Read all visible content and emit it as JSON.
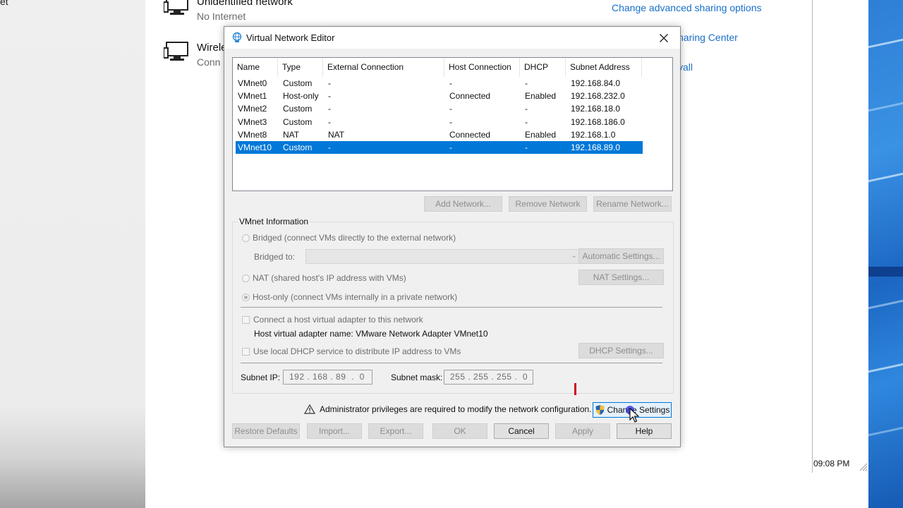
{
  "background": {
    "left_fragment": "et",
    "networks": [
      {
        "name": "Unidentified network",
        "status": "No Internet"
      },
      {
        "name": "Wirele",
        "status": "Conn"
      }
    ],
    "links": {
      "advanced_sharing": "Change advanced sharing options",
      "sharing_center": "haring Center",
      "firewall": "vall"
    },
    "clock": "09:08 PM"
  },
  "dialog": {
    "title": "Virtual Network Editor",
    "table": {
      "columns": [
        "Name",
        "Type",
        "External Connection",
        "Host Connection",
        "DHCP",
        "Subnet Address"
      ],
      "rows": [
        [
          "VMnet0",
          "Custom",
          "-",
          "-",
          "-",
          "192.168.84.0"
        ],
        [
          "VMnet1",
          "Host-only",
          "-",
          "Connected",
          "Enabled",
          "192.168.232.0"
        ],
        [
          "VMnet2",
          "Custom",
          "-",
          "-",
          "-",
          "192.168.18.0"
        ],
        [
          "VMnet3",
          "Custom",
          "-",
          "-",
          "-",
          "192.168.186.0"
        ],
        [
          "VMnet8",
          "NAT",
          "NAT",
          "Connected",
          "Enabled",
          "192.168.1.0"
        ],
        [
          "VMnet10",
          "Custom",
          "-",
          "-",
          "-",
          "192.168.89.0"
        ]
      ],
      "selected_row": 5
    },
    "buttons": {
      "add_network": "Add Network...",
      "remove_network": "Remove Network",
      "rename_network": "Rename Network...",
      "automatic_settings": "Automatic Settings...",
      "nat_settings": "NAT Settings...",
      "dhcp_settings": "DHCP Settings...",
      "change_settings": "Change Settings",
      "restore_defaults": "Restore Defaults",
      "import": "Import...",
      "export": "Export...",
      "ok": "OK",
      "cancel": "Cancel",
      "apply": "Apply",
      "help": "Help"
    },
    "vmnet_info": {
      "group_label": "VMnet Information",
      "bridged_label": "Bridged (connect VMs directly to the external network)",
      "bridged_to_label": "Bridged to:",
      "bridged_to_value": "",
      "nat_label": "NAT (shared host's IP address with VMs)",
      "hostonly_label": "Host-only (connect VMs internally in a private network)",
      "selected_mode": "Host-only",
      "connect_adapter_label": "Connect a host virtual adapter to this network",
      "connect_adapter_checked": false,
      "adapter_name_text": "Host virtual adapter name: VMware Network Adapter VMnet10",
      "dhcp_label": "Use local DHCP service to distribute IP address to VMs",
      "dhcp_checked": false,
      "subnet_ip_label": "Subnet IP:",
      "subnet_ip_value": "192 . 168 . 89  .  0",
      "subnet_mask_label": "Subnet mask:",
      "subnet_mask_value": "255 . 255 . 255 .  0"
    },
    "admin_warning": "Administrator privileges are required to modify the network configuration."
  },
  "colors": {
    "selection": "#0078d7",
    "link": "#1a6fc9",
    "dialog_bg": "#f0f0f0",
    "desktop": "#2e7fd6"
  }
}
